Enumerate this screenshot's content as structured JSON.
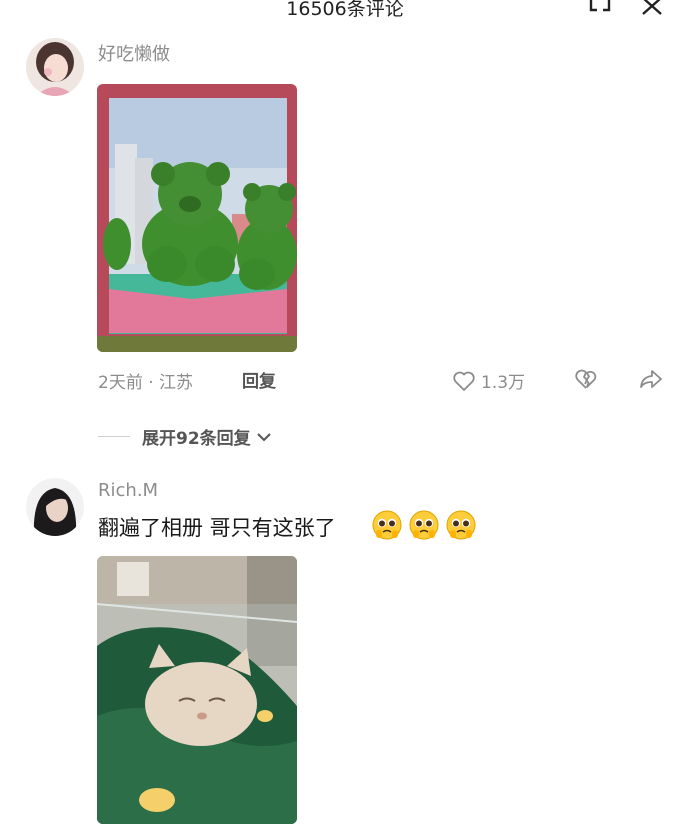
{
  "header": {
    "title": "16506条评论",
    "icons": [
      "exit-fullscreen-icon",
      "close-icon"
    ]
  },
  "comments": [
    {
      "username": "好吃懒做",
      "image_alt": "green topiary teddy bears",
      "time_location": "2天前 · 江苏",
      "reply_label": "回复",
      "likes": "1.3万",
      "expand_label": "展开92条回复"
    },
    {
      "username": "Rich.M",
      "text": "翻遍了相册 哥只有这张了",
      "emojis": [
        "pleading-face-emoji",
        "pleading-face-emoji",
        "pleading-face-emoji"
      ],
      "image_alt": "cat sleeping under green blanket"
    }
  ],
  "colors": {
    "meta_gray": "#8c8c8c",
    "background": "#ffffff",
    "topiary_green": "#3f8f2e"
  }
}
